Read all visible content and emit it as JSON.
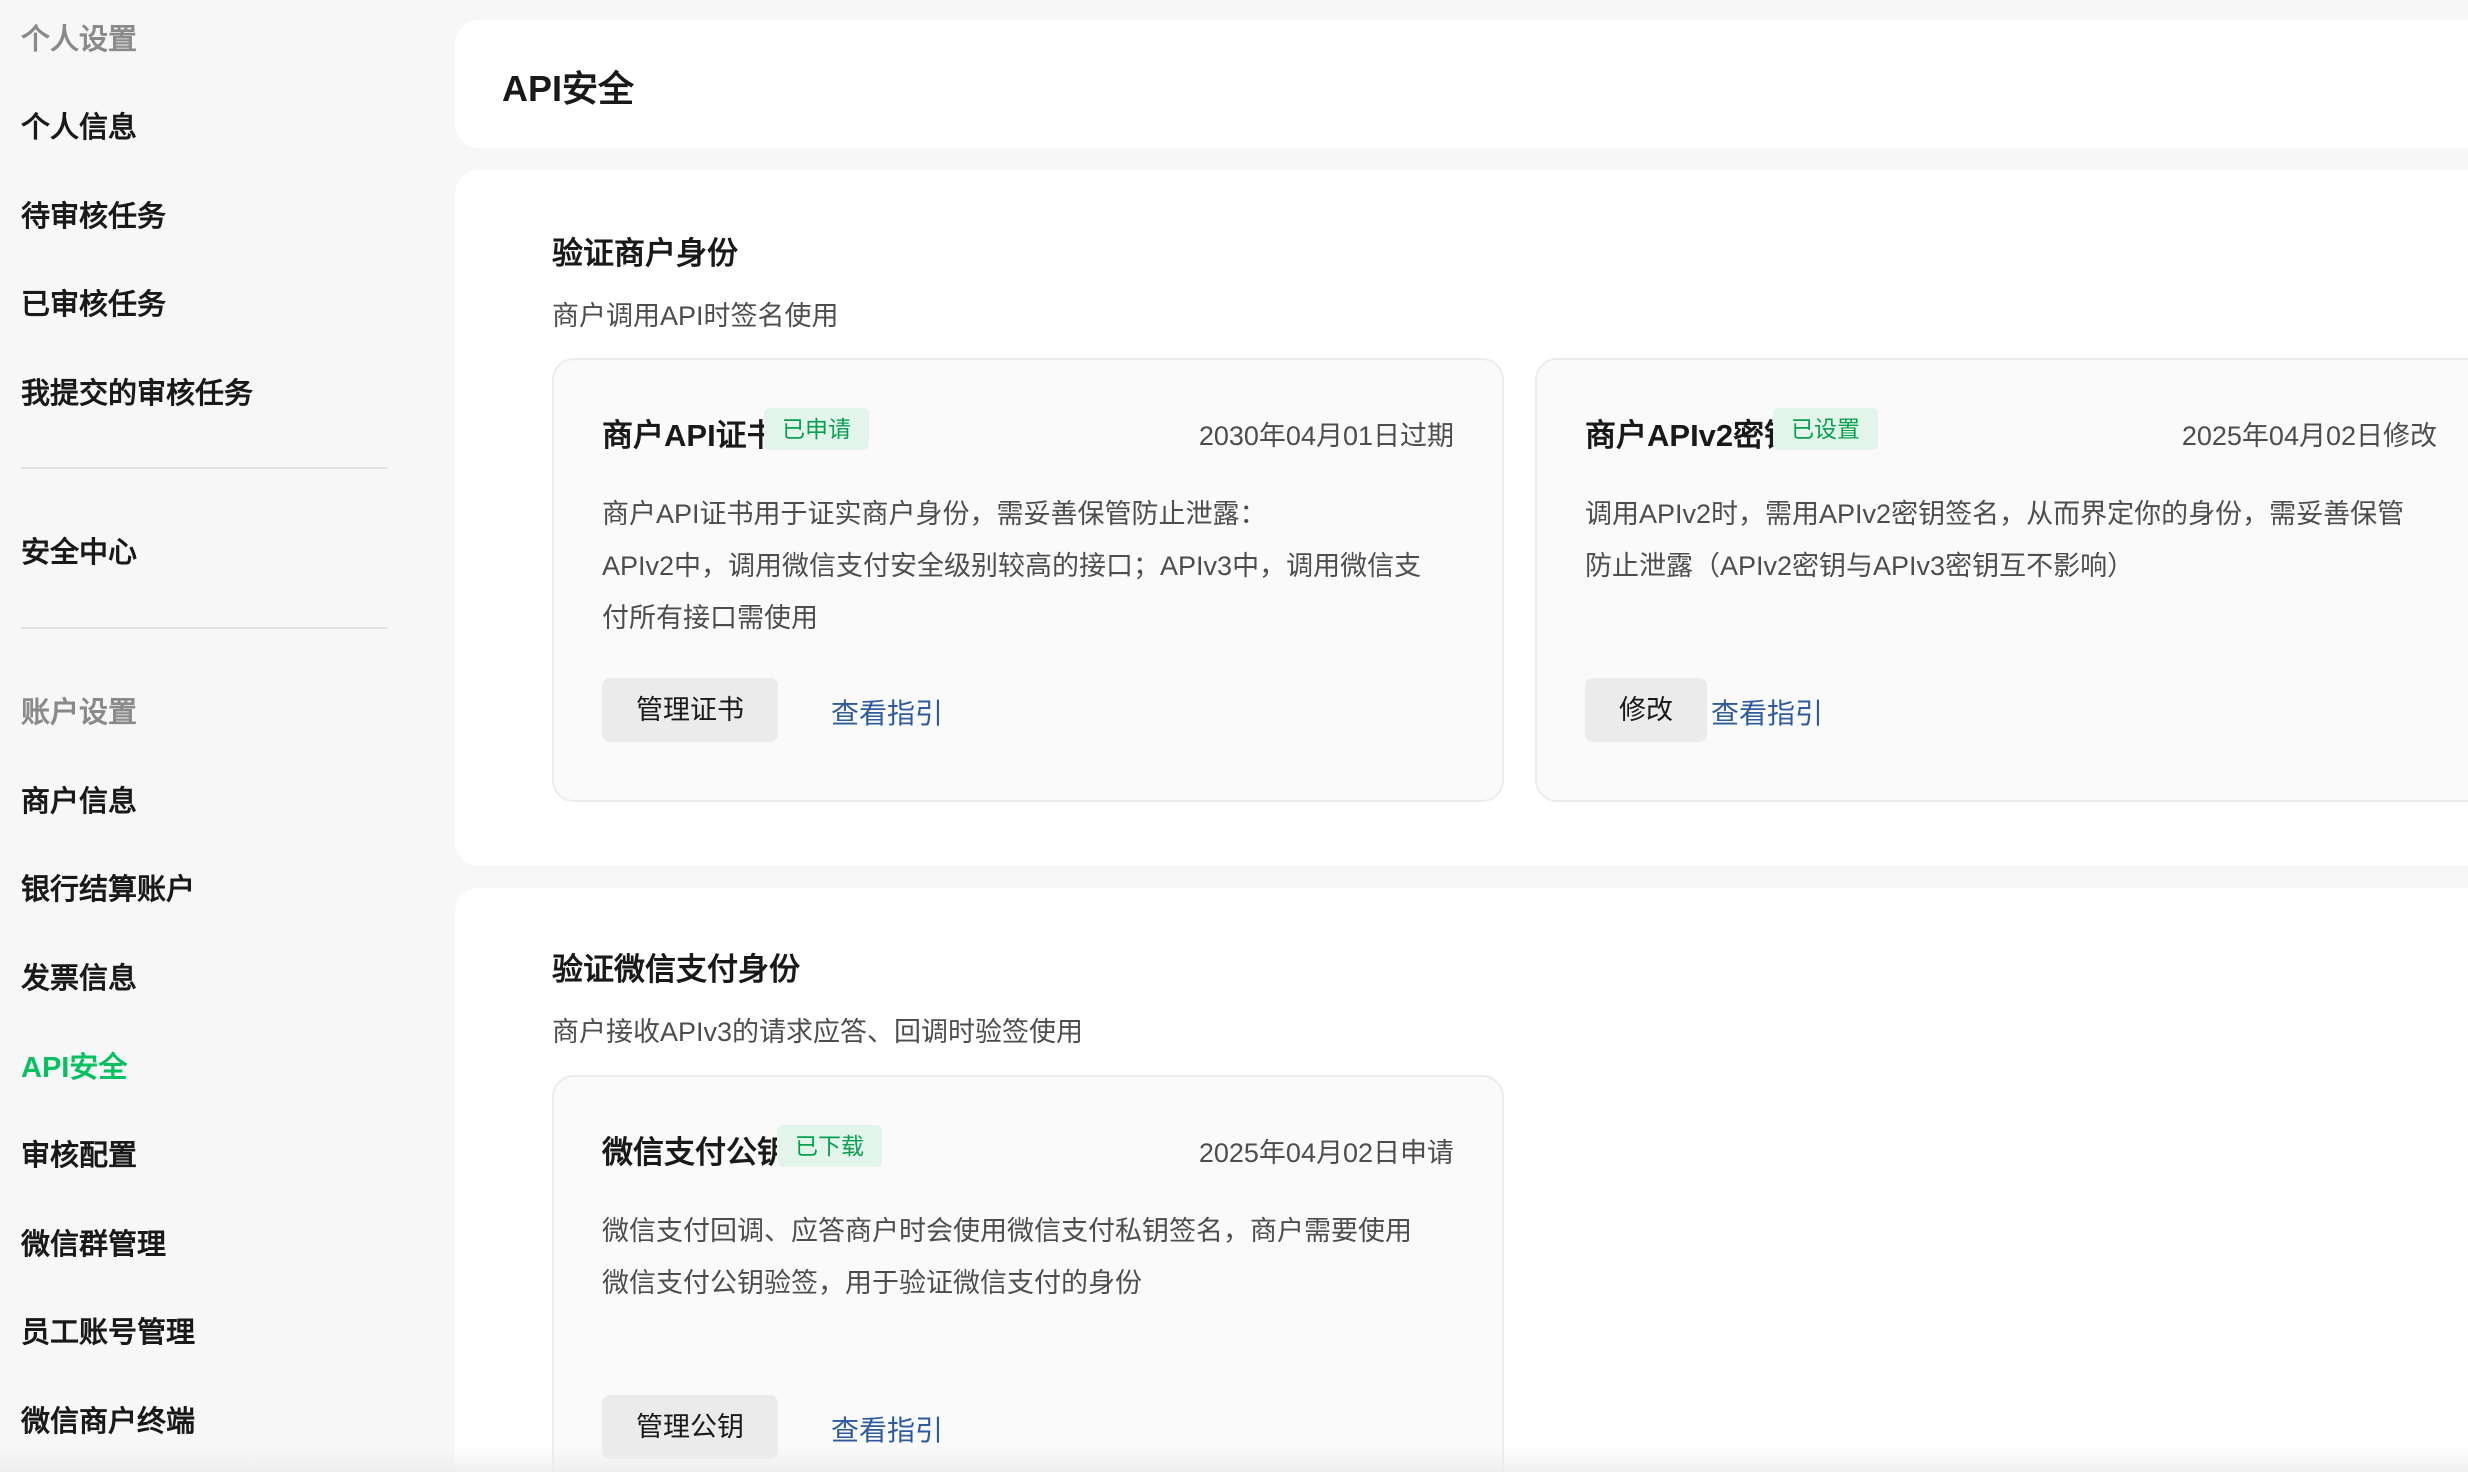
{
  "sidebar": {
    "group_personal": "个人设置",
    "items_personal": [
      "个人信息",
      "待审核任务",
      "已审核任务",
      "我提交的审核任务"
    ],
    "security_center": "安全中心",
    "group_account": "账户设置",
    "items_account": [
      "商户信息",
      "银行结算账户",
      "发票信息",
      "API安全",
      "审核配置",
      "微信群管理",
      "员工账号管理",
      "微信商户终端"
    ],
    "active_item": "API安全"
  },
  "header": {
    "title": "API安全"
  },
  "section1": {
    "title": "验证商户身份",
    "desc": "商户调用API时签名使用",
    "card_cert": {
      "title": "商户API证书",
      "badge": "已申请",
      "meta": "2030年04月01日过期",
      "desc_line1": "商户API证书用于证实商户身份，需妥善保管防止泄露：",
      "desc_line2": "APIv2中，调用微信支付安全级别较高的接口；APIv3中，调用微信支",
      "desc_line3": "付所有接口需使用",
      "button": "管理证书",
      "link": "查看指引"
    },
    "card_key": {
      "title": "商户APIv2密钥",
      "badge": "已设置",
      "meta": "2025年04月02日修改",
      "desc_line1": "调用APIv2时，需用APIv2密钥签名，从而界定你的身份，需妥善保管",
      "desc_line2": "防止泄露（APIv2密钥与APIv3密钥互不影响）",
      "button": "修改",
      "link": "查看指引"
    }
  },
  "section2": {
    "title": "验证微信支付身份",
    "desc": "商户接收APIv3的请求应答、回调时验签使用",
    "card_pubkey": {
      "title": "微信支付公钥",
      "badge": "已下载",
      "meta": "2025年04月02日申请",
      "desc_line1": "微信支付回调、应答商户时会使用微信支付私钥签名，商户需要使用",
      "desc_line2": "微信支付公钥验签，用于验证微信支付的身份",
      "button": "管理公钥",
      "link": "查看指引"
    }
  },
  "colors": {
    "accent": "#07c160",
    "badge_bg": "#e3f5ea",
    "link": "#2e5a9e",
    "background": "#f7f7f7"
  }
}
